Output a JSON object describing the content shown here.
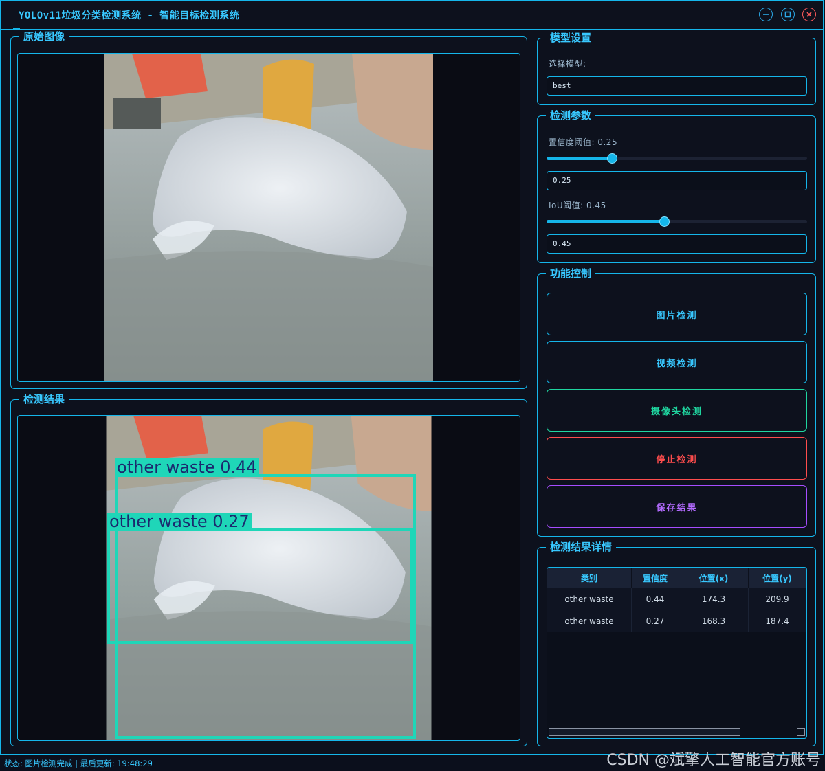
{
  "window": {
    "title": "YOLOv11垃圾分类检测系统 - 智能目标检测系统",
    "controls": [
      "minimize-icon",
      "maximize-icon",
      "close-icon"
    ]
  },
  "left": {
    "original_title": "原始图像",
    "result_title": "检测结果",
    "detections": [
      {
        "label": "other waste 0.44"
      },
      {
        "label": "other waste 0.27"
      }
    ]
  },
  "model": {
    "group_title": "模型设置",
    "select_label": "选择模型:",
    "selected": "best"
  },
  "params": {
    "group_title": "检测参数",
    "conf_label": "置信度阈值: 0.25",
    "conf_value": "0.25",
    "conf_level": 0.25,
    "iou_label": "IoU阈值: 0.45",
    "iou_value": "0.45",
    "iou_level": 0.45
  },
  "functions": {
    "group_title": "功能控制",
    "image_detect": "图片检测",
    "video_detect": "视频检测",
    "camera_detect": "摄像头检测",
    "stop_detect": "停止检测",
    "save_result": "保存结果"
  },
  "details": {
    "group_title": "检测结果详情",
    "columns": [
      "类别",
      "置信度",
      "位置(x)",
      "位置(y)"
    ],
    "rows": [
      [
        "other waste",
        "0.44",
        "174.3",
        "209.9"
      ],
      [
        "other waste",
        "0.27",
        "168.3",
        "187.4"
      ]
    ]
  },
  "status": {
    "text": "状态: 图片检测完成 | 最后更新: 19:48:29"
  },
  "watermark": "CSDN @斌擎人工智能官方账号",
  "colors": {
    "accent": "#15b6ea",
    "image_btn": "#15b6ea",
    "video_btn": "#15b6ea",
    "camera_btn": "#1fd6a0",
    "stop_btn": "#ff4d4d",
    "save_btn": "#a64dff",
    "detection": "#1fd6b8"
  }
}
